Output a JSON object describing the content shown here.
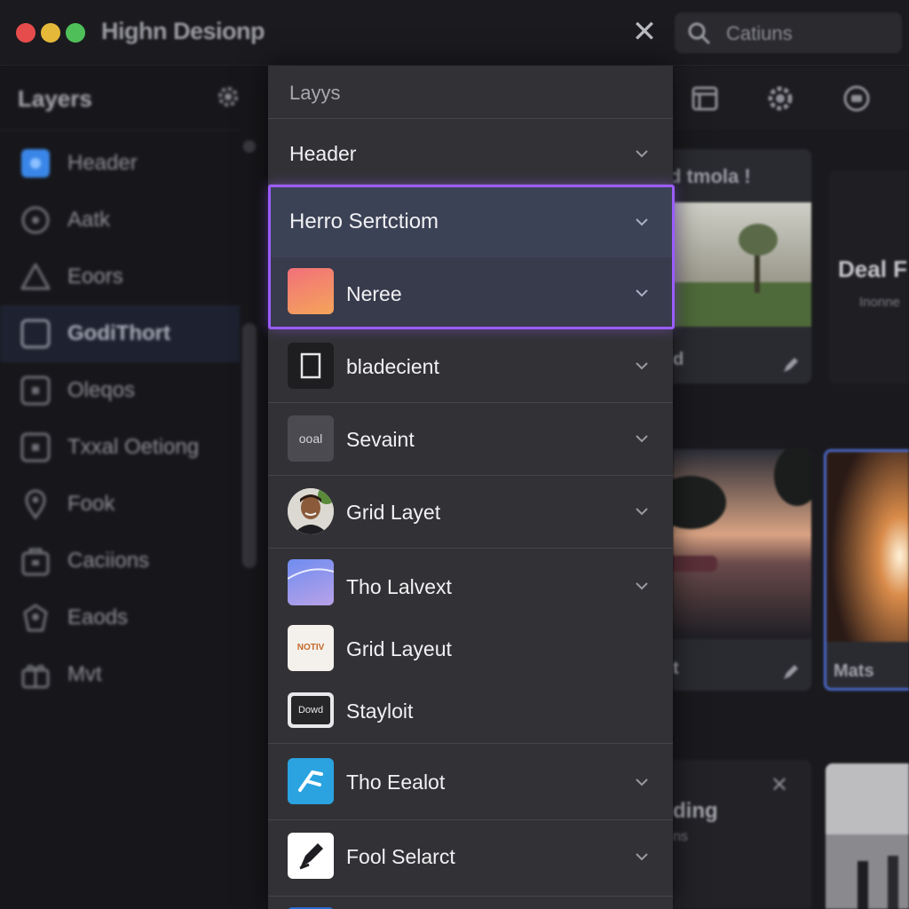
{
  "window": {
    "title": "Highn Desionp",
    "close_glyph": "✕",
    "search_placeholder": "Catiuns"
  },
  "sidebar": {
    "title": "Layers",
    "items": [
      {
        "label": "Header",
        "icon": "square-filled-icon"
      },
      {
        "label": "Aatk",
        "icon": "circle-icon"
      },
      {
        "label": "Eoors",
        "icon": "triangle-icon"
      },
      {
        "label": "GodiThort",
        "icon": "square-icon",
        "selected": true
      },
      {
        "label": "Oleqos",
        "icon": "square-dot-icon"
      },
      {
        "label": "Txxal Oetiong",
        "icon": "square-dot-icon"
      },
      {
        "label": "Fook",
        "icon": "pin-icon"
      },
      {
        "label": "Caciions",
        "icon": "bag-icon"
      },
      {
        "label": "Eaods",
        "icon": "badge-icon"
      },
      {
        "label": "Mvt",
        "icon": "gift-icon"
      }
    ]
  },
  "panel": {
    "header": "Layys",
    "rows": [
      {
        "label": "Header"
      },
      {
        "label": "Herro Sertctiom"
      },
      {
        "label": "Neree"
      },
      {
        "label": "bladecient"
      },
      {
        "label": "Sevaint",
        "thumb_text": "ooal"
      },
      {
        "label": "Grid Layet"
      },
      {
        "label": "Tho Lalvext"
      },
      {
        "label": "Grid Layeut",
        "thumb_text": "NOTIV"
      },
      {
        "label": "Stayloit",
        "thumb_text": "Dowd"
      },
      {
        "label": "Tho Eealot"
      },
      {
        "label": "Fool Selarct"
      }
    ]
  },
  "canvas": {
    "card1_title": "d tmola !",
    "card1_footer": "d",
    "card2_title": "Deal F",
    "card2_sub": "Inonne",
    "card3_footer": "t",
    "card4_footer": "Mats",
    "card5_title": "ding",
    "card5_sub": "ns"
  },
  "colors": {
    "accent": "#9b5cff",
    "panel_bg": "#323236",
    "selected_row": "#3a3f52"
  }
}
